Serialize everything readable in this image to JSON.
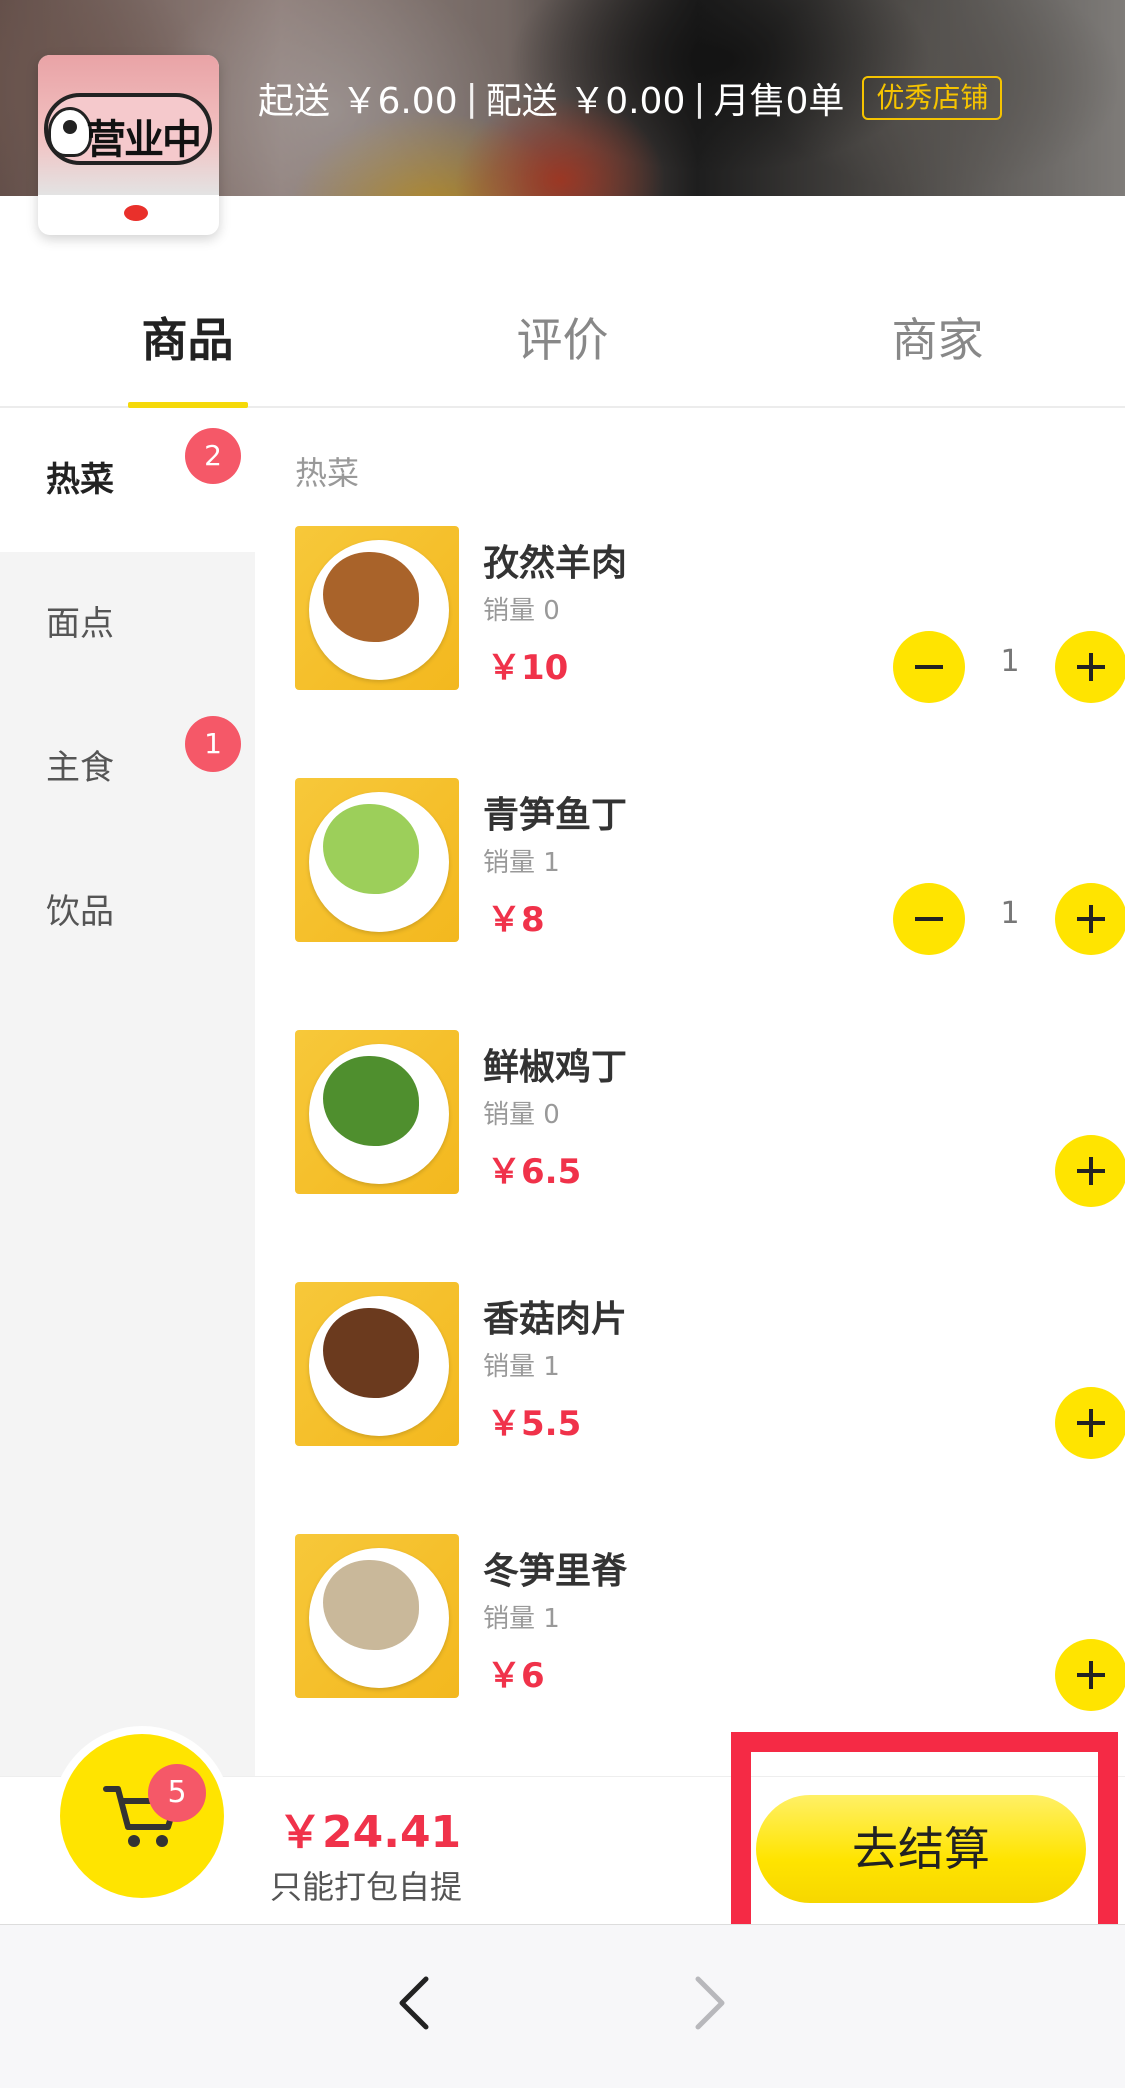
{
  "shop": {
    "logo_text": "营业中",
    "min_order": "起送 ￥6.00",
    "delivery": "配送 ￥0.00",
    "monthly_sales": "月售0单",
    "badge": "优秀店铺"
  },
  "tabs": [
    {
      "label": "商品",
      "active": true
    },
    {
      "label": "评价",
      "active": false
    },
    {
      "label": "商家",
      "active": false
    }
  ],
  "categories": [
    {
      "label": "热菜",
      "count": "2",
      "active": true
    },
    {
      "label": "面点",
      "count": "",
      "active": false
    },
    {
      "label": "主食",
      "count": "1",
      "active": false
    },
    {
      "label": "饮品",
      "count": "",
      "active": false
    }
  ],
  "section_title": "热菜",
  "foods": [
    {
      "name": "孜然羊肉",
      "sales": "销量 0",
      "price": "￥10",
      "qty": "1",
      "in_cart": true,
      "dish_color": "#a9632a"
    },
    {
      "name": "青笋鱼丁",
      "sales": "销量 1",
      "price": "￥8",
      "qty": "1",
      "in_cart": true,
      "dish_color": "#9ccf5a"
    },
    {
      "name": "鲜椒鸡丁",
      "sales": "销量 0",
      "price": "￥6.5",
      "qty": "",
      "in_cart": false,
      "dish_color": "#4f8f2e"
    },
    {
      "name": "香菇肉片",
      "sales": "销量 1",
      "price": "￥5.5",
      "qty": "",
      "in_cart": false,
      "dish_color": "#6b3a1e"
    },
    {
      "name": "冬笋里脊",
      "sales": "销量 1",
      "price": "￥6",
      "qty": "",
      "in_cart": false,
      "dish_color": "#c9b89a"
    }
  ],
  "cart": {
    "count": "5",
    "total": "￥24.41",
    "note": "只能打包自提",
    "checkout_label": "去结算"
  },
  "colors": {
    "accent_yellow": "#ffe400",
    "price_red": "#f0324a",
    "badge_red": "#f55868",
    "highlight_red": "#f52a45"
  }
}
